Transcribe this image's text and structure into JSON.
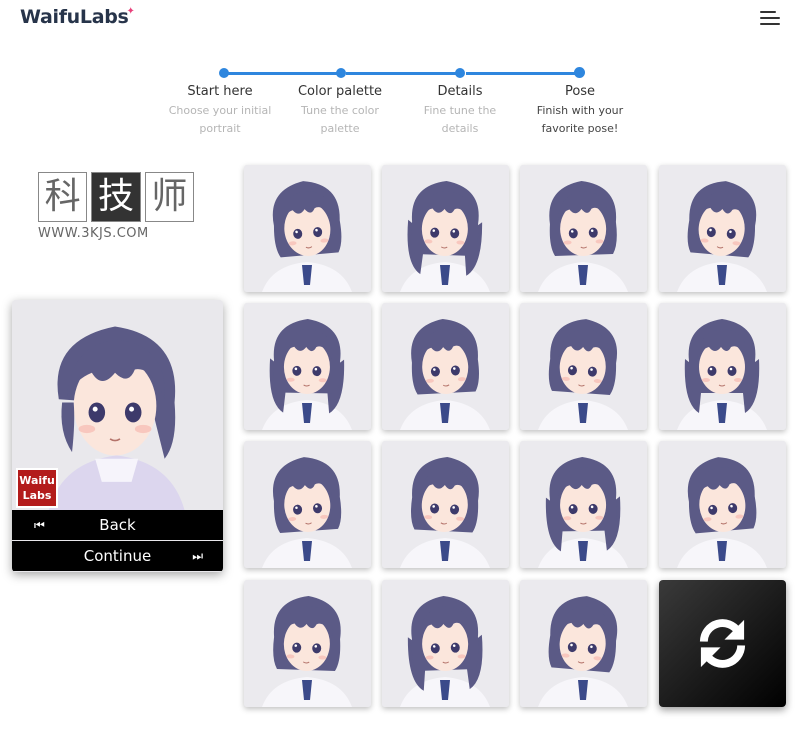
{
  "header": {
    "logo_text": "WaifuLabs",
    "menu_icon": "hamburger-menu-icon"
  },
  "steps": [
    {
      "title": "Start here",
      "desc": "Choose your initial portrait",
      "state": "done"
    },
    {
      "title": "Color palette",
      "desc": "Tune the color palette",
      "state": "done"
    },
    {
      "title": "Details",
      "desc": "Fine tune the details",
      "state": "done"
    },
    {
      "title": "Pose",
      "desc": "Finish with your favorite pose!",
      "state": "active"
    }
  ],
  "watermark": {
    "chars": [
      "科",
      "技",
      "师"
    ],
    "url": "WWW.3KJS.COM"
  },
  "preview": {
    "badge": "Waifu Labs",
    "back_label": "Back",
    "continue_label": "Continue"
  },
  "grid": {
    "tile_count": 15,
    "refresh_icon": "refresh-icon"
  },
  "colors": {
    "accent": "#2e86de",
    "hair": "#5b5a86",
    "skin": "#fbe6dc",
    "button": "#000000"
  }
}
